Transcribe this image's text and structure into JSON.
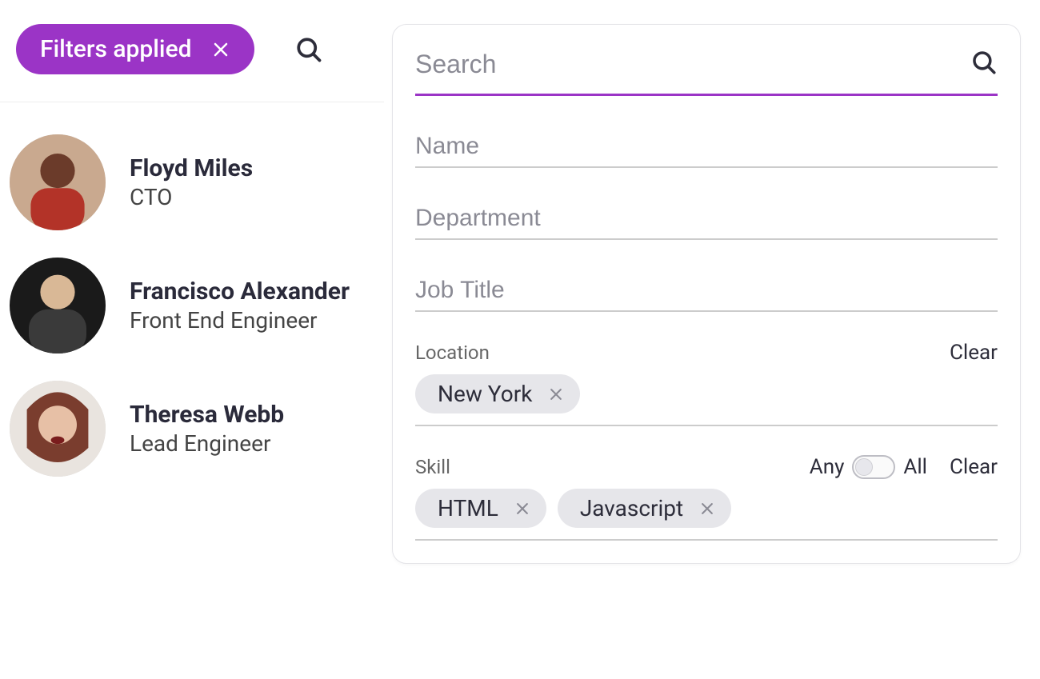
{
  "colors": {
    "accent": "#9b34c6"
  },
  "header": {
    "filter_pill_label": "Filters applied"
  },
  "people": [
    {
      "name": "Floyd Miles",
      "title": "CTO",
      "avatar_bg": "#b54a3a"
    },
    {
      "name": "Francisco Alexander",
      "title": "Front End Engineer",
      "avatar_bg": "#2b2b2b"
    },
    {
      "name": "Theresa Webb",
      "title": "Lead Engineer",
      "avatar_bg": "#a4674f"
    }
  ],
  "panel": {
    "search_placeholder": "Search",
    "fields": {
      "name_placeholder": "Name",
      "department_placeholder": "Department",
      "job_title_placeholder": "Job Title"
    },
    "location": {
      "label": "Location",
      "clear_label": "Clear",
      "chips": [
        "New York"
      ]
    },
    "skill": {
      "label": "Skill",
      "toggle_left": "Any",
      "toggle_right": "All",
      "toggle_state": "any",
      "clear_label": "Clear",
      "chips": [
        "HTML",
        "Javascript"
      ]
    }
  }
}
